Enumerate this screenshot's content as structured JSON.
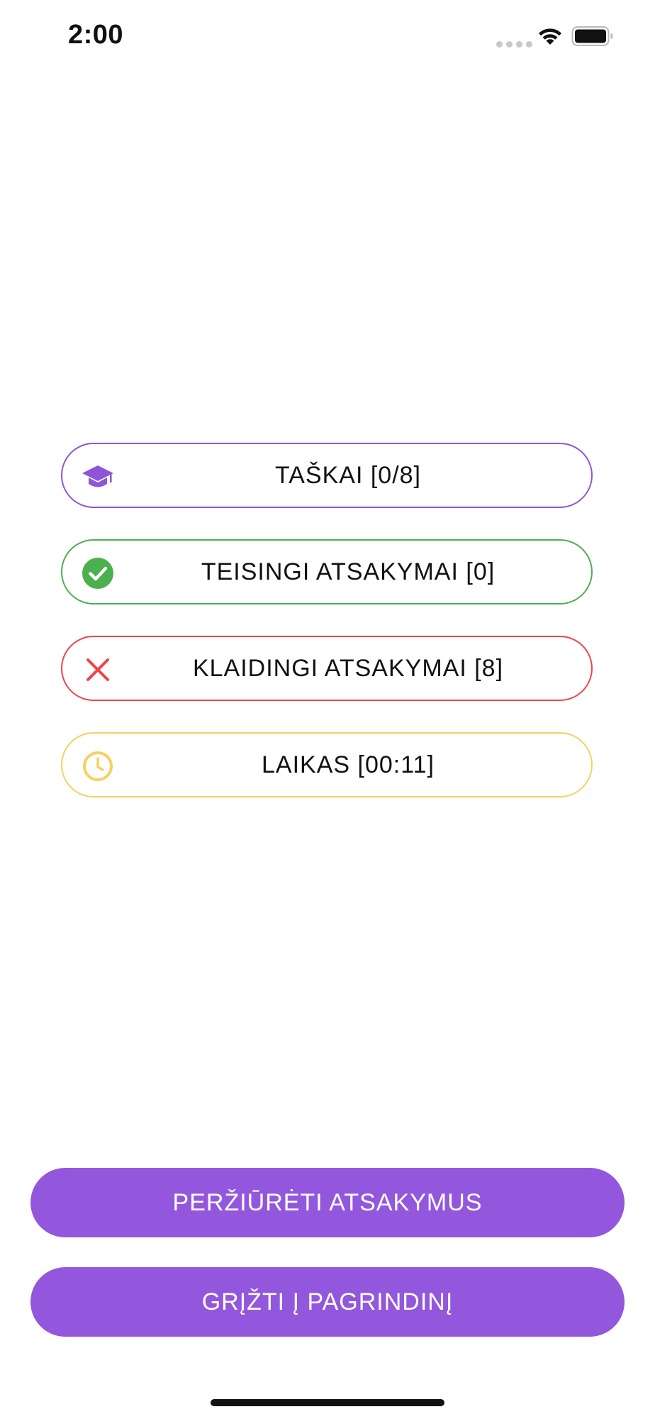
{
  "status_bar": {
    "time": "2:00"
  },
  "stats": [
    {
      "icon": "graduation-cap-icon",
      "label": "TAŠKAI [0/8]",
      "color": "#8e56d6"
    },
    {
      "icon": "check-circle-icon",
      "label": "TEISINGI ATSAKYMAI [0]",
      "color": "#4caf50"
    },
    {
      "icon": "close-icon",
      "label": "KLAIDINGI ATSAKYMAI [8]",
      "color": "#f0434b"
    },
    {
      "icon": "clock-icon",
      "label": "LAIKAS [00:11]",
      "color": "#f5d064"
    }
  ],
  "actions": {
    "review_label": "PERŽIŪRĖTI ATSAKYMUS",
    "home_label": "GRĮŽTI Į PAGRINDINĮ",
    "color": "#9357dd"
  }
}
